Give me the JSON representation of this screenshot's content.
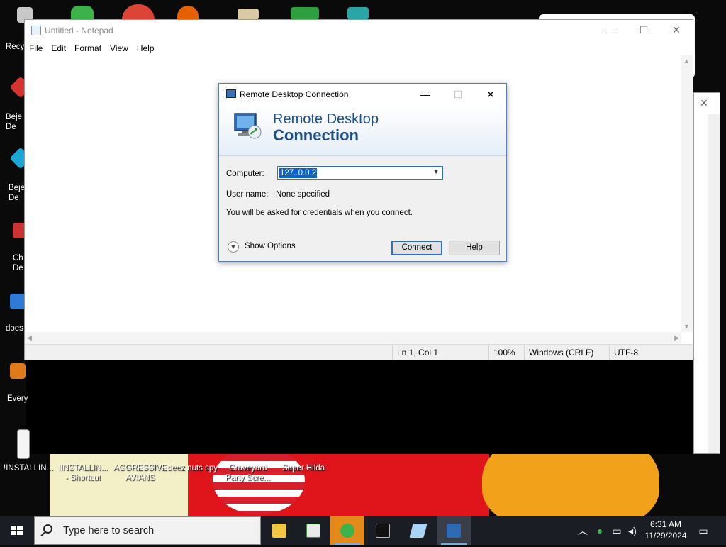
{
  "desktop": {
    "icons": [
      {
        "label": "Recy",
        "icon": "recycle-bin-icon"
      },
      {
        "label": "Beje\nDe",
        "icon": "game-gem-icon"
      },
      {
        "label": "Beje\nDe",
        "icon": "game-gem-icon"
      },
      {
        "label": "Ch\nDe",
        "icon": "game-icon"
      },
      {
        "label": "does",
        "icon": "file-shortcut-icon"
      },
      {
        "label": "Every",
        "icon": "file-shortcut-icon"
      }
    ],
    "bottom_icons": [
      {
        "label": "!INSTALLIN..."
      },
      {
        "label": "!INSTALLIN...\n- Shortcut"
      },
      {
        "label": "AGGRESSIVE\nAVIANS"
      },
      {
        "label": "deez nuts spy"
      },
      {
        "label": "Graveyard\nParty Scre..."
      },
      {
        "label": "Super Hilda"
      }
    ]
  },
  "notepad": {
    "title": "Untitled - Notepad",
    "menu": [
      "File",
      "Edit",
      "Format",
      "View",
      "Help"
    ],
    "content": "",
    "status": {
      "position": "Ln 1, Col 1",
      "zoom": "100%",
      "line_ending": "Windows (CRLF)",
      "encoding": "UTF-8"
    }
  },
  "rdc": {
    "title": "Remote Desktop Connection",
    "banner_line1": "Remote Desktop",
    "banner_line2": "Connection",
    "computer_label": "Computer:",
    "computer_value": "127..0.0.2",
    "username_label": "User name:",
    "username_value": "None specified",
    "info": "You will be asked for credentials when you connect.",
    "show_options": "Show Options",
    "connect": "Connect",
    "help": "Help"
  },
  "taskbar": {
    "search_placeholder": "Type here to search",
    "apps": [
      "file-explorer-icon",
      "notepad-app-icon",
      "people-app-icon",
      "terminal-icon",
      "notepad-pen-icon",
      "remote-desktop-icon"
    ],
    "time": "6:31 AM",
    "date": "11/29/2024"
  },
  "colors": {
    "accent": "#2f6fbf",
    "rdc_title_blue": "#1d4f8b",
    "taskbar_bg": "#1a1d24"
  }
}
